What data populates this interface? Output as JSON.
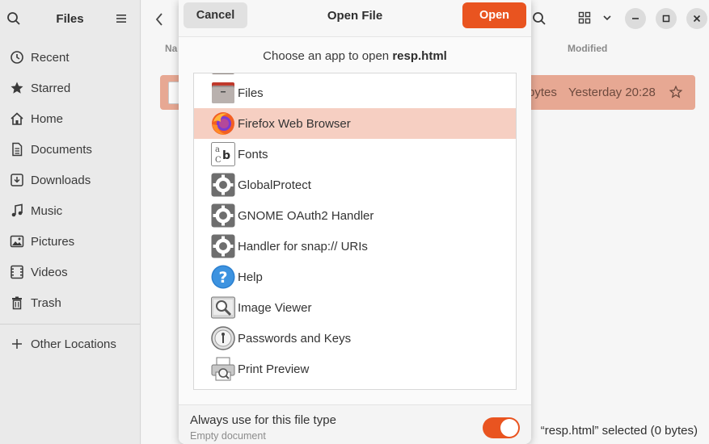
{
  "files_window": {
    "title": "Files",
    "sidebar": [
      {
        "label": "Recent",
        "icon": "clock-icon"
      },
      {
        "label": "Starred",
        "icon": "star-icon"
      },
      {
        "label": "Home",
        "icon": "home-icon"
      },
      {
        "label": "Documents",
        "icon": "document-icon"
      },
      {
        "label": "Downloads",
        "icon": "download-icon"
      },
      {
        "label": "Music",
        "icon": "music-icon"
      },
      {
        "label": "Pictures",
        "icon": "picture-icon"
      },
      {
        "label": "Videos",
        "icon": "video-icon"
      },
      {
        "label": "Trash",
        "icon": "trash-icon"
      },
      {
        "label": "Other Locations",
        "icon": "plus-icon"
      }
    ],
    "columns": {
      "name": "Na",
      "size": "e",
      "modified": "Modified"
    },
    "file_row": {
      "size": "bytes",
      "modified": "Yesterday 20:28"
    },
    "status": "“resp.html” selected  (0 bytes)"
  },
  "dialog": {
    "title": "Open File",
    "cancel_label": "Cancel",
    "open_label": "Open",
    "prompt_text": "Choose an app to open",
    "file_name": "resp.html",
    "apps": [
      {
        "label": "Files",
        "icon": "files-icon"
      },
      {
        "label": "Firefox Web Browser",
        "icon": "firefox-icon",
        "selected": true
      },
      {
        "label": "Fonts",
        "icon": "fonts-icon"
      },
      {
        "label": "GlobalProtect",
        "icon": "gear-icon"
      },
      {
        "label": "GNOME OAuth2 Handler",
        "icon": "gear-icon"
      },
      {
        "label": "Handler for snap:// URIs",
        "icon": "gear-icon"
      },
      {
        "label": "Help",
        "icon": "help-icon"
      },
      {
        "label": "Image Viewer",
        "icon": "image-viewer-icon"
      },
      {
        "label": "Passwords and Keys",
        "icon": "passwords-icon"
      },
      {
        "label": "Print Preview",
        "icon": "printer-icon"
      }
    ],
    "footer": {
      "always_label": "Always use for this file type",
      "sub_label": "Empty document",
      "toggle_on": true
    }
  },
  "colors": {
    "accent": "#e95420",
    "selection": "#f6cfc2"
  }
}
